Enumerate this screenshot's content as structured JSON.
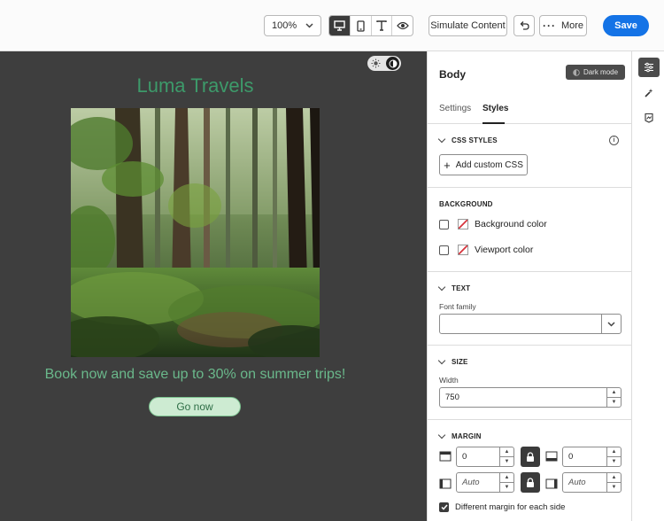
{
  "toolbar": {
    "zoom_value": "100%",
    "simulate_label": "Simulate Content",
    "more_label": "More",
    "save_label": "Save",
    "view_modes": [
      "desktop-icon",
      "mobile-icon",
      "text-icon",
      "preview-eye-icon"
    ],
    "active_view": "desktop"
  },
  "canvas": {
    "email_title": "Luma Travels",
    "promo_text": "Book now and save up to 30% on summer trips!",
    "cta_label": "Go now",
    "title_color": "#3d9a6a",
    "background_color": "#3e3e3e"
  },
  "panel": {
    "title": "Body",
    "dark_mode_label": "Dark mode",
    "tabs": [
      {
        "label": "Settings",
        "active": false
      },
      {
        "label": "Styles",
        "active": true
      }
    ],
    "css_styles": {
      "heading": "CSS STYLES",
      "add_label": "Add custom CSS"
    },
    "background": {
      "heading": "BACKGROUND",
      "items": [
        {
          "label": "Background color"
        },
        {
          "label": "Viewport color"
        }
      ]
    },
    "text": {
      "heading": "TEXT",
      "font_family_label": "Font family",
      "font_family_value": ""
    },
    "size": {
      "heading": "SIZE",
      "width_label": "Width",
      "width_value": "750"
    },
    "margin": {
      "heading": "MARGIN",
      "top": "0",
      "bottom": "0",
      "left": "Auto",
      "right": "Auto",
      "different_each_side_label": "Different margin for each side",
      "different_each_side_checked": true
    }
  },
  "rail": {
    "icons": [
      "properties-icon",
      "magic-wand-icon",
      "image-asset-icon"
    ]
  },
  "colors": {
    "accent": "#1473e6",
    "dark_button": "#4b4b4b"
  }
}
